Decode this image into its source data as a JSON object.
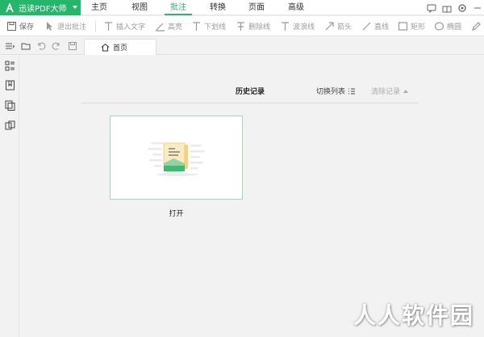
{
  "app": {
    "name": "迅读PDF大师",
    "accent": "#27b46b"
  },
  "menu": {
    "tabs": [
      "主页",
      "视图",
      "批注",
      "转换",
      "页面",
      "高级"
    ],
    "active": "批注"
  },
  "toolbar": {
    "items": [
      {
        "label": "保存",
        "icon": "save-icon"
      },
      {
        "label": "退出批注",
        "icon": "cursor-icon"
      },
      {
        "label": "插入文字",
        "icon": "text-icon"
      },
      {
        "label": "高亮",
        "icon": "highlight-icon"
      },
      {
        "label": "下划线",
        "icon": "underline-icon"
      },
      {
        "label": "删除线",
        "icon": "strikethrough-icon"
      },
      {
        "label": "波浪线",
        "icon": "wavy-line-icon"
      },
      {
        "label": "箭头",
        "icon": "arrow-icon"
      },
      {
        "label": "直线",
        "icon": "line-icon"
      },
      {
        "label": "矩形",
        "icon": "rectangle-icon"
      },
      {
        "label": "椭圆",
        "icon": "ellipse-icon"
      }
    ]
  },
  "tabs": {
    "home": "首页"
  },
  "history": {
    "title": "历史记录",
    "switch_list": "切换列表",
    "clear": "清除记录"
  },
  "open_card": {
    "label": "打开"
  },
  "watermark": "人人软件园"
}
